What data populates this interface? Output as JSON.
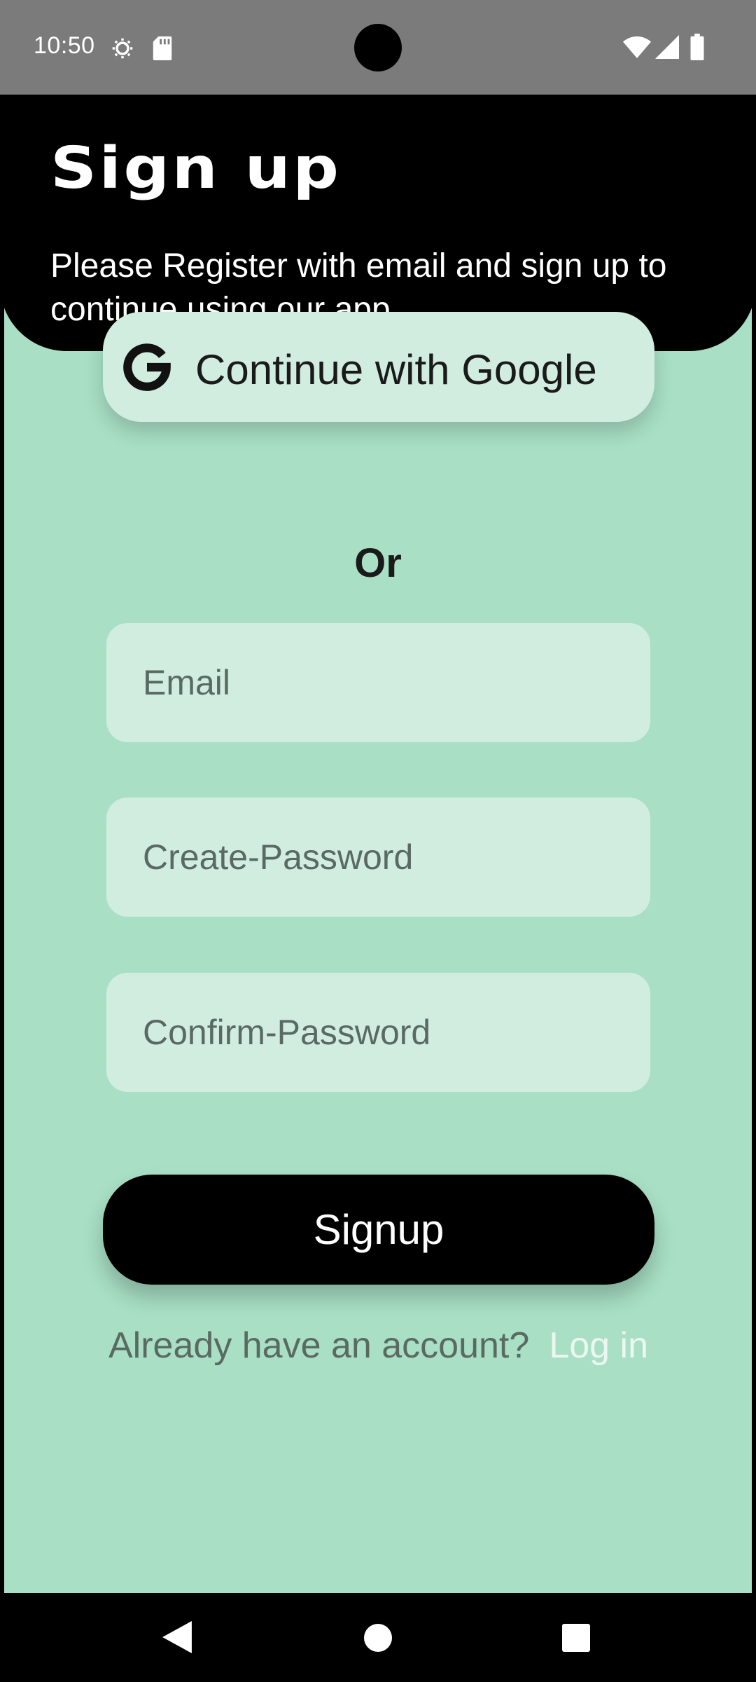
{
  "status_bar": {
    "time": "10:50",
    "icons": [
      "gear-icon",
      "sd-card-icon",
      "wifi-icon",
      "signal-icon",
      "battery-icon"
    ]
  },
  "header": {
    "title": "Sign up",
    "subtitle": "Please Register with email and sign up to continue using our app."
  },
  "google_button": {
    "label": "Continue with Google",
    "icon": "google-icon"
  },
  "divider_text": "Or",
  "form": {
    "email_placeholder": "Email",
    "email_value": "",
    "create_password_placeholder": "Create-Password",
    "create_password_value": "",
    "confirm_password_placeholder": "Confirm-Password",
    "confirm_password_value": ""
  },
  "signup_button": {
    "label": "Signup"
  },
  "login": {
    "prompt": "Already have an account?",
    "link": "Log in"
  },
  "nav_bar": {
    "icons": [
      "back-icon",
      "home-icon",
      "recents-icon"
    ]
  },
  "colors": {
    "background": "#a8dfc5",
    "field": "#d0ede0",
    "header": "#000000",
    "status_bar": "#7b7b7b"
  }
}
